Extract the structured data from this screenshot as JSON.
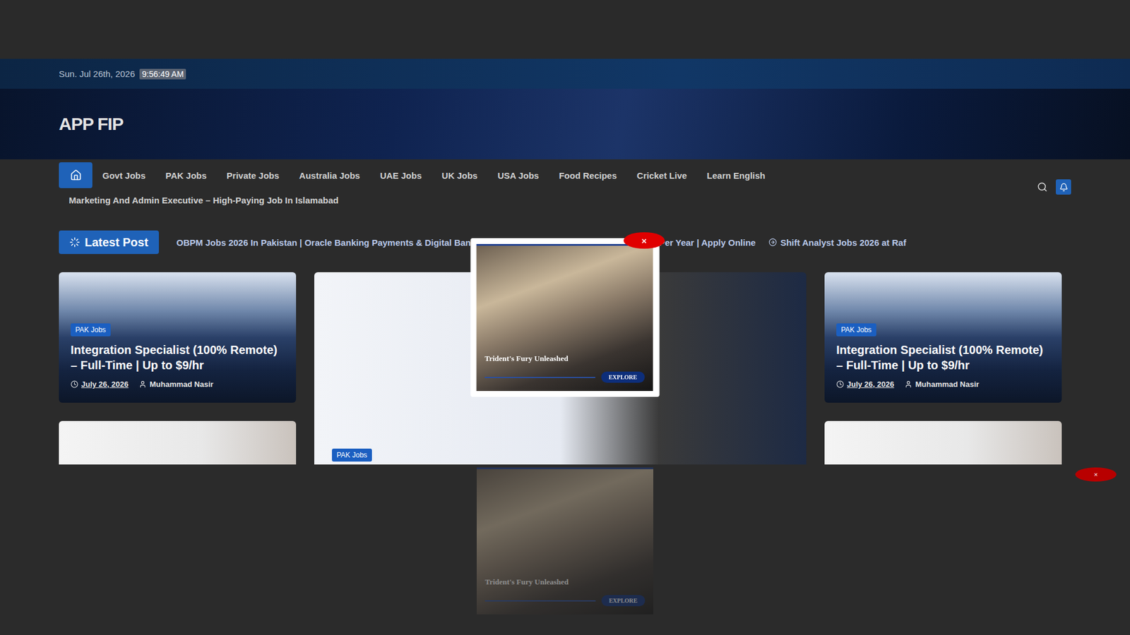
{
  "top_bar": {
    "date": "Sun. Jul 26th, 2026",
    "time": "9:56:49 AM"
  },
  "site": {
    "title": "APP FIP"
  },
  "nav": {
    "home": {
      "selected": true
    },
    "items": [
      {
        "label": "Govt Jobs",
        "selected": false
      },
      {
        "label": "PAK Jobs",
        "selected": false
      },
      {
        "label": "Private Jobs",
        "selected": false
      },
      {
        "label": "Australia Jobs",
        "selected": false
      },
      {
        "label": "UAE Jobs",
        "selected": false
      },
      {
        "label": "UK Jobs",
        "selected": false
      },
      {
        "label": "USA Jobs",
        "selected": false
      },
      {
        "label": "Food Recipes",
        "selected": false
      },
      {
        "label": "Cricket Live",
        "selected": false
      },
      {
        "label": "Learn English",
        "selected": false
      }
    ],
    "sub_items": [
      "Marketing And Admin Executive – High-Paying Job In Islamabad"
    ]
  },
  "latest": {
    "label": "Latest Post",
    "ticker": [
      "OBPM Jobs 2026 In Pakistan | Oracle Banking Payments & Digital Bank",
      "utions Jobs 2026 | Earn $220K-$400K Per Year | Apply Online",
      "Shift Analyst Jobs 2026 at Raf"
    ]
  },
  "cards": [
    {
      "kind": "small",
      "category": "PAK Jobs",
      "title": "Integration Specialist (100% Remote) – Full-Time | Up to $9/hr",
      "date": "July 26, 2026",
      "author": "Muhammad Nasir"
    },
    {
      "kind": "feature",
      "category": "PAK Jobs",
      "title": "",
      "date": "",
      "author": ""
    },
    {
      "kind": "small",
      "category": "PAK Jobs",
      "title": "Integration Specialist (100% Remote) – Full-Time | Up to $9/hr",
      "date": "July 26, 2026",
      "author": "Muhammad Nasir"
    },
    {
      "kind": "image",
      "category": "",
      "title": "",
      "date": "",
      "author": ""
    },
    {
      "kind": "image",
      "category": "",
      "title": "",
      "date": "",
      "author": ""
    }
  ],
  "popup": {
    "title": "Trident's Fury Unleashed",
    "button": "EXPLORE",
    "close": "×"
  },
  "bottom_ad": {
    "title": "Trident's Fury Unleashed",
    "button": "EXPLORE",
    "close": "×"
  }
}
